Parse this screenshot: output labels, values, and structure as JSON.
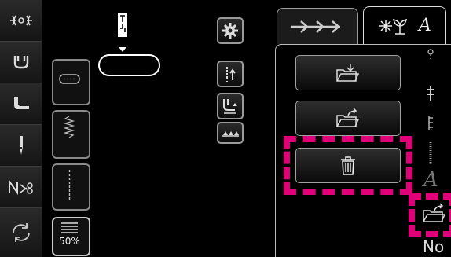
{
  "sidebar": {
    "items": [
      {
        "name": "thread-tension-icon"
      },
      {
        "name": "presser-foot-icon"
      },
      {
        "name": "foot-pressure-icon"
      },
      {
        "name": "needle-icon"
      },
      {
        "name": "cut-thread-icon"
      },
      {
        "name": "reset-icon"
      }
    ]
  },
  "stitch_column": {
    "zoom_label": "50%"
  },
  "tabs": {
    "tab1_icon": "arrows-icon",
    "tab2_letter": "A"
  },
  "panel": {
    "side_letter": "A",
    "bottom_text": "No"
  },
  "highlight_color": "#e0007a"
}
